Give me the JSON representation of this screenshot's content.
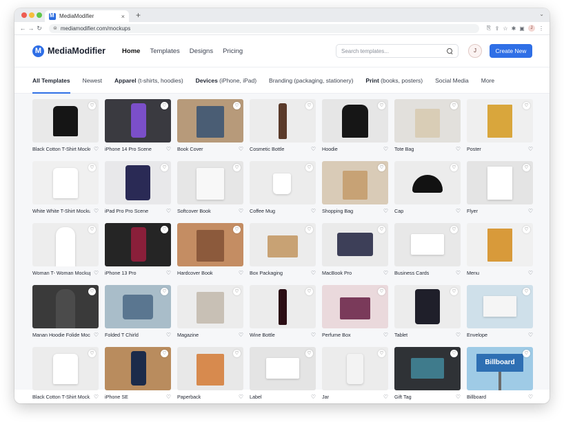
{
  "browser": {
    "tab_title": "MediaModifier",
    "tab_close": "×",
    "new_tab": "+",
    "url": "mediamodifier.com/mockups",
    "profile_initial": "J"
  },
  "header": {
    "logo_text": "MediaModifier",
    "nav": [
      {
        "label": "Home",
        "active": true
      },
      {
        "label": "Templates"
      },
      {
        "label": "Designs"
      },
      {
        "label": "Pricing"
      }
    ],
    "search_placeholder": "Search templates...",
    "avatar_initial": "J",
    "create_button": "Create New"
  },
  "filters": [
    {
      "label": "All Templates",
      "active": true
    },
    {
      "label": "Newest"
    },
    {
      "bold": "Apparel",
      "rest": " (t-shirts, hoodies)"
    },
    {
      "bold": "Devices",
      "rest": " (iPhone, iPad)"
    },
    {
      "label": "Branding (packaging, stationery)"
    },
    {
      "bold": "Print",
      "rest": " (books, posters)"
    },
    {
      "label": "Social Media"
    },
    {
      "label": "More"
    }
  ],
  "icons": {
    "heart": "♡"
  },
  "colors": {
    "accent": "#2f6fe6"
  },
  "templates": [
    {
      "label": "Black Cotton T-Shirt Mockup",
      "bg": "#e9e9e9",
      "obj": "#151515",
      "kind": "tshirt"
    },
    {
      "label": "iPhone 14 Pro Scene",
      "bg": "#3a3a40",
      "obj": "#7b4fc9",
      "kind": "phone"
    },
    {
      "label": "Book Cover",
      "bg": "#b79a7a",
      "obj": "#4a5d74",
      "kind": "book"
    },
    {
      "label": "Cosmetic Bottle",
      "bg": "#ececec",
      "obj": "#5a3a2a",
      "kind": "bottle"
    },
    {
      "label": "Hoodie",
      "bg": "#e6e6e6",
      "obj": "#161616",
      "kind": "hoodie"
    },
    {
      "label": "Tote Bag",
      "bg": "#e2e0dc",
      "obj": "#d9cdb6",
      "kind": "bag"
    },
    {
      "label": "Poster",
      "bg": "#efefef",
      "obj": "#d9a63c",
      "kind": "poster"
    },
    {
      "label": "White White T-Shirt Mockup",
      "bg": "#f0f0f0",
      "obj": "#ffffff",
      "kind": "tshirt"
    },
    {
      "label": "iPad Pro Pro Scene",
      "bg": "#e8e8ea",
      "obj": "#2a2a55",
      "kind": "tablet"
    },
    {
      "label": "Softcover Book",
      "bg": "#e6e6e6",
      "obj": "#f8f8f8",
      "kind": "book"
    },
    {
      "label": "Coffee Mug",
      "bg": "#ececec",
      "obj": "#ffffff",
      "kind": "mug"
    },
    {
      "label": "Shopping Bag",
      "bg": "#d9cbb7",
      "obj": "#c7a275",
      "kind": "bag"
    },
    {
      "label": "Cap",
      "bg": "#ececec",
      "obj": "#121212",
      "kind": "cap"
    },
    {
      "label": "Flyer",
      "bg": "#e4e4e4",
      "obj": "#ffffff",
      "kind": "poster"
    },
    {
      "label": "Woman T- Woman Mockup",
      "bg": "#ededed",
      "obj": "#ffffff",
      "kind": "person"
    },
    {
      "label": "iPhone 13 Pro",
      "bg": "#252525",
      "obj": "#8a1f3a",
      "kind": "phone"
    },
    {
      "label": "Hardcover Book",
      "bg": "#c48d63",
      "obj": "#8c5a3c",
      "kind": "book"
    },
    {
      "label": "Box Packaging",
      "bg": "#ececec",
      "obj": "#c8a274",
      "kind": "box"
    },
    {
      "label": "MacBook Pro",
      "bg": "#eaeaea",
      "obj": "#3d3f58",
      "kind": "laptop"
    },
    {
      "label": "Business Cards",
      "bg": "#e8e8e8",
      "obj": "#ffffff",
      "kind": "cards"
    },
    {
      "label": "Menu",
      "bg": "#f0f0f0",
      "obj": "#d89a3a",
      "kind": "poster"
    },
    {
      "label": "Manan Hoodie Folide Mock.",
      "bg": "#3a3a3a",
      "obj": "#4b4b4b",
      "kind": "person"
    },
    {
      "label": "Folded T Chirld",
      "bg": "#a9bdc9",
      "obj": "#5a7690",
      "kind": "folded"
    },
    {
      "label": "Magazine",
      "bg": "#ececec",
      "obj": "#c8c0b5",
      "kind": "book"
    },
    {
      "label": "Wine Bottle",
      "bg": "#ececec",
      "obj": "#2b0d14",
      "kind": "bottle"
    },
    {
      "label": "Perfume Box",
      "bg": "#ead9dc",
      "obj": "#7a3a5a",
      "kind": "box"
    },
    {
      "label": "Tablet",
      "bg": "#ececec",
      "obj": "#1f1f2a",
      "kind": "tablet"
    },
    {
      "label": "Envelope",
      "bg": "#cfe0ea",
      "obj": "#f5f5f5",
      "kind": "envelope"
    },
    {
      "label": "Black Cotton T-Shirt Mock...",
      "bg": "#ececec",
      "obj": "#ffffff",
      "kind": "tshirt"
    },
    {
      "label": "iPhone SE",
      "bg": "#b98c5e",
      "obj": "#1c2b4a",
      "kind": "phone"
    },
    {
      "label": "Paperback",
      "bg": "#e8e8e8",
      "obj": "#d78a4e",
      "kind": "book"
    },
    {
      "label": "Label",
      "bg": "#e4e4e4",
      "obj": "#ffffff",
      "kind": "cards"
    },
    {
      "label": "Jar",
      "bg": "#ececec",
      "obj": "#f3f3f3",
      "kind": "jar"
    },
    {
      "label": "Gift Tag",
      "bg": "#2f3236",
      "obj": "#3f7b8c",
      "kind": "cards"
    },
    {
      "label": "Billboard",
      "bg": "#9fcbe6",
      "obj": "#2e6fb3",
      "kind": "billboard",
      "text": "Billboard"
    }
  ]
}
